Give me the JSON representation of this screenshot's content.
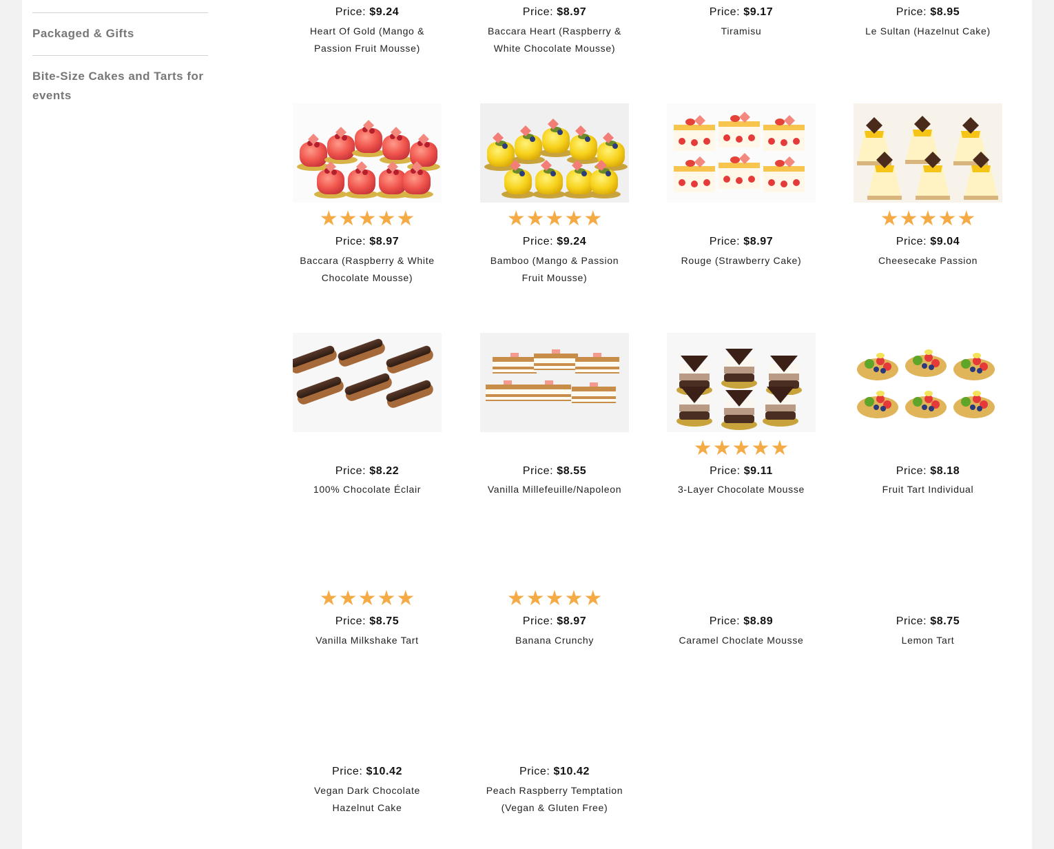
{
  "sidebar": {
    "items": [
      {
        "label": "Packaged & Gifts"
      },
      {
        "label": "Bite-Size Cakes and Tarts for events"
      }
    ]
  },
  "products": [
    {
      "price_label": "Price:",
      "price": "$9.24",
      "name": "Heart Of Gold (Mango & Passion Fruit Mousse)",
      "rating": null,
      "image": "none"
    },
    {
      "price_label": "Price:",
      "price": "$8.97",
      "name": "Baccara Heart (Raspberry & White Chocolate Mousse)",
      "rating": null,
      "image": "none"
    },
    {
      "price_label": "Price:",
      "price": "$9.17",
      "name": "Tiramisu",
      "rating": null,
      "image": "none"
    },
    {
      "price_label": "Price:",
      "price": "$8.95",
      "name": "Le Sultan (Hazelnut Cake)",
      "rating": null,
      "image": "none"
    },
    {
      "price_label": "Price:",
      "price": "$8.97",
      "name": "Baccara (Raspberry & White Chocolate Mousse)",
      "rating": 5,
      "image": "red-domes"
    },
    {
      "price_label": "Price:",
      "price": "$9.24",
      "name": "Bamboo (Mango & Passion Fruit Mousse)",
      "rating": 5,
      "image": "yellow-domes"
    },
    {
      "price_label": "Price:",
      "price": "$8.97",
      "name": "Rouge (Strawberry Cake)",
      "rating": null,
      "image": "strawberry-cakes"
    },
    {
      "price_label": "Price:",
      "price": "$9.04",
      "name": "Cheesecake Passion",
      "rating": 5,
      "image": "cheesecake-slices"
    },
    {
      "price_label": "Price:",
      "price": "$8.22",
      "name": "100% Chocolate Éclair",
      "rating": null,
      "image": "eclairs"
    },
    {
      "price_label": "Price:",
      "price": "$8.55",
      "name": "Vanilla Millefeuille/Napoleon",
      "rating": null,
      "image": "millefeuille"
    },
    {
      "price_label": "Price:",
      "price": "$9.11",
      "name": "3-Layer Chocolate Mousse",
      "rating": 5,
      "image": "layer-mousse"
    },
    {
      "price_label": "Price:",
      "price": "$8.18",
      "name": "Fruit Tart Individual",
      "rating": null,
      "image": "fruit-tarts"
    },
    {
      "price_label": "Price:",
      "price": "$8.75",
      "name": "Vanilla Milkshake Tart",
      "rating": 5,
      "image": "none"
    },
    {
      "price_label": "Price:",
      "price": "$8.97",
      "name": "Banana Crunchy",
      "rating": 5,
      "image": "none"
    },
    {
      "price_label": "Price:",
      "price": "$8.89",
      "name": "Caramel Choclate Mousse",
      "rating": null,
      "image": "none"
    },
    {
      "price_label": "Price:",
      "price": "$8.75",
      "name": "Lemon Tart",
      "rating": null,
      "image": "none"
    },
    {
      "price_label": "Price:",
      "price": "$10.42",
      "name": "Vegan Dark Chocolate Hazelnut Cake",
      "rating": null,
      "image": "none"
    },
    {
      "price_label": "Price:",
      "price": "$10.42",
      "name": "Peach Raspberry Temptation (Vegan & Gluten Free)",
      "rating": null,
      "image": "none"
    }
  ],
  "colors": {
    "star": "#f4ab46",
    "sidebar_text": "#777777",
    "page_bg": "#f2f2f2"
  }
}
